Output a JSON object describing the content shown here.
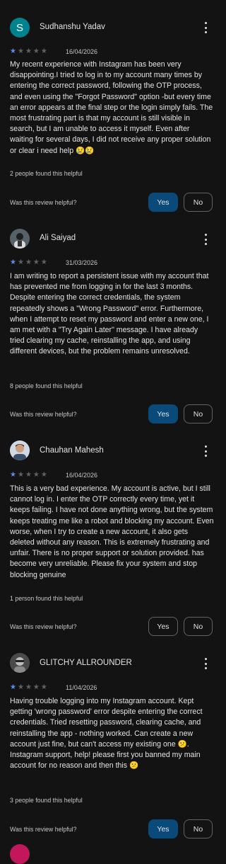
{
  "colors": {
    "background": "#131314",
    "star_on": "#5b8def",
    "star_off": "#5f6368",
    "yes_active": "#0a4a7a",
    "avatar_s": "#00838f"
  },
  "reviews": [
    {
      "name": "Sudhanshu Yadav",
      "avatar_letter": "S",
      "rating": 1,
      "date": "16/04/2026",
      "body": "My recent experience with Instagram has been very disappointing.I tried to log in to my account many times by entering the correct password, following the OTP process, and even using the \"Forgot Password\" option -but every time an error appears at the final step or the login simply fails. The most frustrating part is that my account is still visible in search, but I am unable to access it myself. Even after waiting for several days, I did not receive any proper solution or clear i need help 😢😢",
      "helpful_count": "2 people found this helpful",
      "question": "Was this review helpful?",
      "yes": "Yes",
      "no": "No",
      "yes_selected": true
    },
    {
      "name": "Ali Saiyad",
      "rating": 1,
      "date": "31/03/2026",
      "body": "I am writing to report a persistent issue with my account that has prevented me from logging in for the last 3 months. Despite entering the correct credentials, the system repeatedly shows a \"Wrong Password\" error. Furthermore, when I attempt to reset my password and enter a new one, I am met with a \"Try Again Later\" message. I have already tried clearing my cache, reinstalling the app, and using different devices, but the problem remains unresolved.",
      "helpful_count": "8 people found this helpful",
      "question": "Was this review helpful?",
      "yes": "Yes",
      "no": "No",
      "yes_selected": true
    },
    {
      "name": "Chauhan Mahesh",
      "rating": 1,
      "date": "16/04/2026",
      "body": "This is a very bad experience. My account is active, but I still cannot log in. I enter the OTP correctly every time, yet it keeps failing. I have not done anything wrong, but the system keeps treating me like a robot and blocking my account. Even worse, when I try to create a new account, it also gets deleted without any reason. This is extremely frustrating and unfair. There is no proper support or solution provided. has become very unreliable. Please fix your system and stop blocking genuine",
      "helpful_count": "1 person found this helpful",
      "question": "Was this review helpful?",
      "yes": "Yes",
      "no": "No",
      "yes_selected": false
    },
    {
      "name": "GLITCHY ALLROUNDER",
      "rating": 1,
      "date": "11/04/2026",
      "body": "Having trouble logging into my Instagram account. Kept getting 'wrong password' error despite entering the correct credentials. Tried resetting password, clearing cache, and reinstalling the app - nothing worked. Can create a new account just fine, but can't access my existing one 😕. Instagram support, help! please first you banned my main account for no reason and then this 😕",
      "helpful_count": "3 people found this helpful",
      "question": "Was this review helpful?",
      "yes": "Yes",
      "no": "No",
      "yes_selected": true
    }
  ]
}
